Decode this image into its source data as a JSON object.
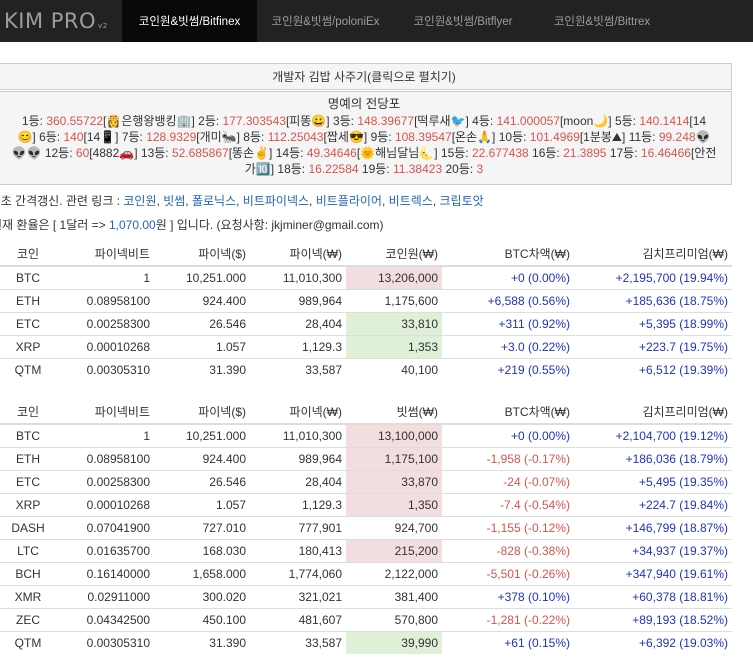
{
  "nav": {
    "brand": "KIM PRO",
    "brand_sub": "v2",
    "items": [
      {
        "label": "코인원&빗썸/Bitfinex",
        "active": true
      },
      {
        "label": "코인원&빗썸/poloniEx",
        "active": false
      },
      {
        "label": "코인원&빗썸/Bitflyer",
        "active": false
      },
      {
        "label": "코인원&빗썸/Bittrex",
        "active": false
      }
    ]
  },
  "banner": "개발자 김밥 사주기(클릭으로 펼치기)",
  "hall": {
    "title": "명예의 전당포",
    "line1": [
      {
        "t": "1등: "
      },
      {
        "t": "360.55722",
        "r": true
      },
      {
        "t": "[👸은행왕뱅킹🏢] "
      },
      {
        "t": "2등: "
      },
      {
        "t": "177.303543",
        "r": true
      },
      {
        "t": "[피똥😀] "
      },
      {
        "t": "3등: "
      },
      {
        "t": "148.39677",
        "r": true
      },
      {
        "t": "[떡루새🐦] "
      },
      {
        "t": "4등: "
      },
      {
        "t": "141.000057",
        "r": true
      },
      {
        "t": "[moon🌙] "
      },
      {
        "t": "5등: "
      },
      {
        "t": "140.1414",
        "r": true
      },
      {
        "t": "[14"
      }
    ],
    "line2": [
      {
        "t": "😊] "
      },
      {
        "t": "6등: "
      },
      {
        "t": "140",
        "r": true
      },
      {
        "t": "[14📱] "
      },
      {
        "t": "7등: "
      },
      {
        "t": "128.9329",
        "r": true
      },
      {
        "t": "[개미🐜] "
      },
      {
        "t": "8등: "
      },
      {
        "t": "112.25043",
        "r": true
      },
      {
        "t": "[짭세😎] "
      },
      {
        "t": "9등: "
      },
      {
        "t": "108.39547",
        "r": true
      },
      {
        "t": "[온손🙏] "
      },
      {
        "t": "10등: "
      },
      {
        "t": "101.4969",
        "r": true
      },
      {
        "t": "[1분봉⛰] "
      },
      {
        "t": "11등: "
      },
      {
        "t": "99.248",
        "r": true
      },
      {
        "t": "👽"
      }
    ],
    "line3": [
      {
        "t": "👽👽 "
      },
      {
        "t": "12등: "
      },
      {
        "t": "60",
        "r": true
      },
      {
        "t": "[4882🚗] "
      },
      {
        "t": "13등: "
      },
      {
        "t": "52.685867",
        "r": true
      },
      {
        "t": "[똥손✌] "
      },
      {
        "t": "14등: "
      },
      {
        "t": "49.34646",
        "r": true
      },
      {
        "t": "[🌞해님달님🌜] "
      },
      {
        "t": "15등: "
      },
      {
        "t": "22.677438",
        "r": true
      },
      {
        "t": " "
      },
      {
        "t": "16등: "
      },
      {
        "t": "21.3895",
        "r": true
      },
      {
        "t": " "
      },
      {
        "t": "17등: "
      },
      {
        "t": "16.46466",
        "r": true
      },
      {
        "t": "[안전"
      }
    ],
    "line4": [
      {
        "t": "가🔟] "
      },
      {
        "t": "18등: "
      },
      {
        "t": "16.22584",
        "r": true
      },
      {
        "t": " "
      },
      {
        "t": "19등: "
      },
      {
        "t": "11.38423",
        "r": true
      },
      {
        "t": " "
      },
      {
        "t": "20등: "
      },
      {
        "t": "3",
        "r": true
      }
    ]
  },
  "info": {
    "interval": "3",
    "interval_text": "초 간격갱신. 관련 링크 : ",
    "links": [
      "코인원",
      "빗썸",
      "폴로닉스",
      "비트파이넥스",
      "비트플라이어",
      "비트렉스",
      "크립토앗"
    ],
    "rate_prefix": "현재 환율은 [ 1달러 => ",
    "rate_value": "1,070.00",
    "rate_suffix": "원 ] 입니다. (요청사항: jkjminer@gmail.com)"
  },
  "table1": {
    "headers": [
      "코인",
      "파이넥비트",
      "파이넥($)",
      "파이넥(₩)",
      "코인원(₩)",
      "BTC차액(₩)",
      "김치프리미엄(₩)"
    ],
    "rows": [
      {
        "coin": "BTC",
        "ratio": "1",
        "usd": "10,251.000",
        "krw": "11,010,300",
        "local": "13,206,000",
        "bg": "red",
        "diff": "+0 (0.00%)",
        "dsign": "pos",
        "kimchi": "+2,195,700 (19.94%)",
        "ksign": "pos"
      },
      {
        "coin": "ETH",
        "ratio": "0.08958100",
        "usd": "924.400",
        "krw": "989,964",
        "local": "1,175,600",
        "bg": "",
        "diff": "+6,588 (0.56%)",
        "dsign": "pos",
        "kimchi": "+185,636 (18.75%)",
        "ksign": "pos"
      },
      {
        "coin": "ETC",
        "ratio": "0.00258300",
        "usd": "26.546",
        "krw": "28,404",
        "local": "33,810",
        "bg": "green",
        "diff": "+311 (0.92%)",
        "dsign": "pos",
        "kimchi": "+5,395 (18.99%)",
        "ksign": "pos"
      },
      {
        "coin": "XRP",
        "ratio": "0.00010268",
        "usd": "1.057",
        "krw": "1,129.3",
        "local": "1,353",
        "bg": "green",
        "diff": "+3.0 (0.22%)",
        "dsign": "pos",
        "kimchi": "+223.7 (19.75%)",
        "ksign": "pos"
      },
      {
        "coin": "QTM",
        "ratio": "0.00305310",
        "usd": "31.390",
        "krw": "33,587",
        "local": "40,100",
        "bg": "",
        "diff": "+219 (0.55%)",
        "dsign": "pos",
        "kimchi": "+6,512 (19.39%)",
        "ksign": "pos"
      }
    ]
  },
  "table2": {
    "headers": [
      "코인",
      "파이넥비트",
      "파이넥($)",
      "파이넥(₩)",
      "빗썸(₩)",
      "BTC차액(₩)",
      "김치프리미엄(₩)"
    ],
    "rows": [
      {
        "coin": "BTC",
        "ratio": "1",
        "usd": "10,251.000",
        "krw": "11,010,300",
        "local": "13,100,000",
        "bg": "red",
        "diff": "+0 (0.00%)",
        "dsign": "pos",
        "kimchi": "+2,104,700 (19.12%)",
        "ksign": "pos"
      },
      {
        "coin": "ETH",
        "ratio": "0.08958100",
        "usd": "924.400",
        "krw": "989,964",
        "local": "1,175,100",
        "bg": "red",
        "diff": "-1,958 (-0.17%)",
        "dsign": "neg",
        "kimchi": "+186,036 (18.79%)",
        "ksign": "pos"
      },
      {
        "coin": "ETC",
        "ratio": "0.00258300",
        "usd": "26.546",
        "krw": "28,404",
        "local": "33,870",
        "bg": "red",
        "diff": "-24 (-0.07%)",
        "dsign": "neg",
        "kimchi": "+5,495 (19.35%)",
        "ksign": "pos"
      },
      {
        "coin": "XRP",
        "ratio": "0.00010268",
        "usd": "1.057",
        "krw": "1,129.3",
        "local": "1,350",
        "bg": "red",
        "diff": "-7.4 (-0.54%)",
        "dsign": "neg",
        "kimchi": "+224.7 (19.84%)",
        "ksign": "pos"
      },
      {
        "coin": "DASH",
        "ratio": "0.07041900",
        "usd": "727.010",
        "krw": "777,901",
        "local": "924,700",
        "bg": "",
        "diff": "-1,155 (-0.12%)",
        "dsign": "neg",
        "kimchi": "+146,799 (18.87%)",
        "ksign": "pos"
      },
      {
        "coin": "LTC",
        "ratio": "0.01635700",
        "usd": "168.030",
        "krw": "180,413",
        "local": "215,200",
        "bg": "red",
        "diff": "-828 (-0.38%)",
        "dsign": "neg",
        "kimchi": "+34,937 (19.37%)",
        "ksign": "pos"
      },
      {
        "coin": "BCH",
        "ratio": "0.16140000",
        "usd": "1,658.000",
        "krw": "1,774,060",
        "local": "2,122,000",
        "bg": "",
        "diff": "-5,501 (-0.26%)",
        "dsign": "neg",
        "kimchi": "+347,940 (19.61%)",
        "ksign": "pos"
      },
      {
        "coin": "XMR",
        "ratio": "0.02911000",
        "usd": "300.020",
        "krw": "321,021",
        "local": "381,400",
        "bg": "",
        "diff": "+378 (0.10%)",
        "dsign": "pos",
        "kimchi": "+60,378 (18.81%)",
        "ksign": "pos"
      },
      {
        "coin": "ZEC",
        "ratio": "0.04342500",
        "usd": "450.100",
        "krw": "481,607",
        "local": "570,800",
        "bg": "",
        "diff": "-1,281 (-0.22%)",
        "dsign": "neg",
        "kimchi": "+89,193 (18.52%)",
        "ksign": "pos"
      },
      {
        "coin": "QTM",
        "ratio": "0.00305310",
        "usd": "31.390",
        "krw": "33,587",
        "local": "39,990",
        "bg": "green",
        "diff": "+61 (0.15%)",
        "dsign": "pos",
        "kimchi": "+6,392 (19.03%)",
        "ksign": "pos"
      }
    ]
  }
}
